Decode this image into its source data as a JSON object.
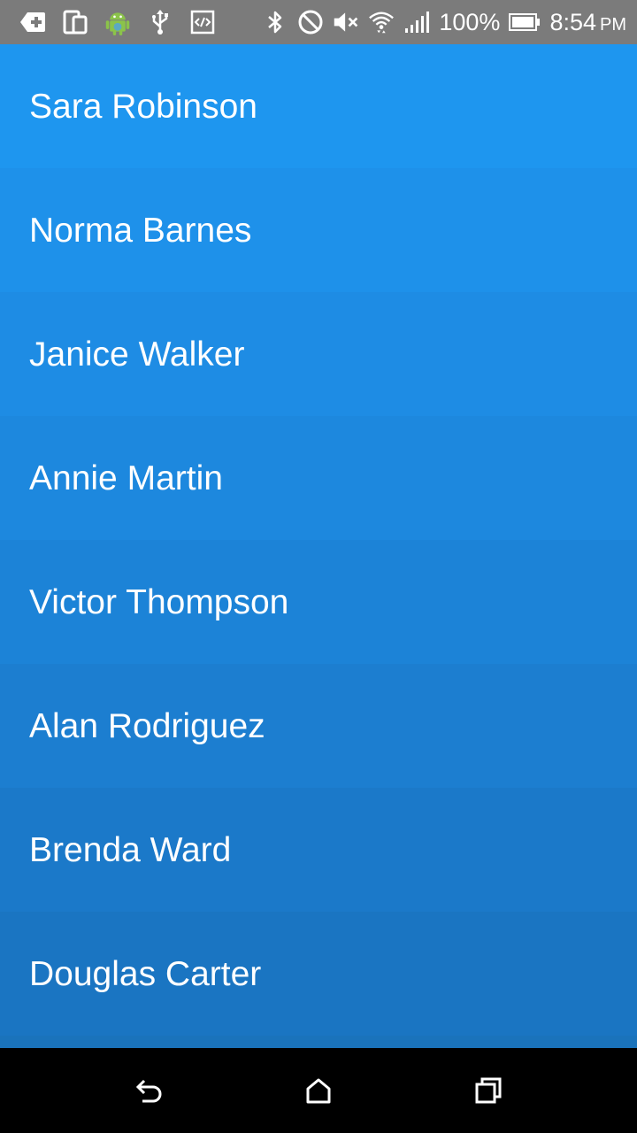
{
  "status_bar": {
    "icons_left": [
      "add-box-icon",
      "device-icon",
      "android-icon",
      "usb-icon",
      "developer-code-icon"
    ],
    "icons_right": [
      "bluetooth-icon",
      "do-not-disturb-icon",
      "volume-muted-icon",
      "wifi-icon",
      "signal-icon"
    ],
    "battery_percent": "100%",
    "battery_icon": "battery-full-icon",
    "time": "8:54",
    "ampm": "PM",
    "background": "#7b7b7b"
  },
  "list": {
    "items": [
      {
        "name": "Sara Robinson",
        "color": "#1e96ef"
      },
      {
        "name": "Norma Barnes",
        "color": "#1e91ea"
      },
      {
        "name": "Janice Walker",
        "color": "#1e8ce4"
      },
      {
        "name": "Annie Martin",
        "color": "#1d88de"
      },
      {
        "name": "Victor Thompson",
        "color": "#1c83d7"
      },
      {
        "name": "Alan Rodriguez",
        "color": "#1c7ed0"
      },
      {
        "name": "Brenda Ward",
        "color": "#1b79c9"
      },
      {
        "name": "Douglas Carter",
        "color": "#1a75c2"
      }
    ]
  },
  "nav_bar": {
    "back_icon": "back-icon",
    "home_icon": "home-icon",
    "recents_icon": "recents-icon"
  }
}
